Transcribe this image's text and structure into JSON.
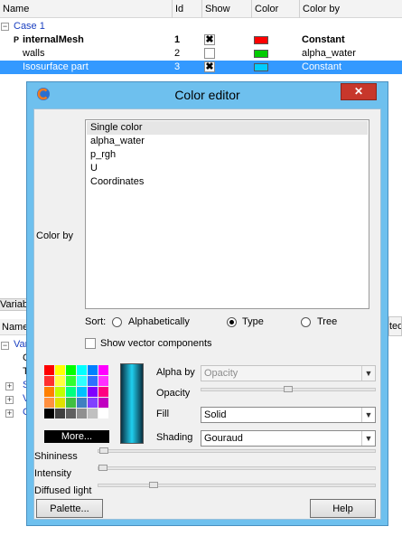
{
  "tree": {
    "columns": [
      "Name",
      "Id",
      "Show",
      "Color",
      "Color by"
    ],
    "rows": [
      {
        "name": "Case 1",
        "id": "",
        "show": "",
        "color": "",
        "color_by": ""
      },
      {
        "name": "internalMesh",
        "id": "1",
        "show": "✖",
        "color": "#ff0000",
        "color_by": "Constant"
      },
      {
        "name": "walls",
        "id": "2",
        "show": "",
        "color": "#00cc00",
        "color_by": "alpha_water"
      },
      {
        "name": "Isosurface part",
        "id": "3",
        "show": "✖",
        "color": "#00ccff",
        "color_by": "Constant"
      }
    ],
    "expander_minus": "−",
    "expander_plus": "+"
  },
  "left_fragments": {
    "variables_tab": "Variab",
    "name_col": "Name",
    "right_col": "ted",
    "items": [
      "Var",
      "C",
      "T",
      "S",
      "V",
      "C"
    ]
  },
  "dialog": {
    "title": "Color editor",
    "close_glyph": "✕",
    "color_by_label": "Color by",
    "color_by_options": [
      "Single color",
      "alpha_water",
      "p_rgh",
      "U",
      "Coordinates"
    ],
    "sort_label": "Sort:",
    "sort_options": [
      "Alphabetically",
      "Type",
      "Tree"
    ],
    "sort_selected": "Type",
    "vector_components_label": "Show vector components",
    "more_label": "More...",
    "alpha_by_label": "Alpha by",
    "alpha_by_value": "Opacity",
    "opacity_label": "Opacity",
    "opacity_level": 0.5,
    "fill_label": "Fill",
    "fill_value": "Solid",
    "shading_label": "Shading",
    "shading_value": "Gouraud",
    "shininess_label": "Shininess",
    "shininess_level": 0.02,
    "intensity_label": "Intensity",
    "intensity_level": 0.0,
    "diffused_label": "Diffused light",
    "diffused_level": 0.2,
    "palette_button": "Palette...",
    "help_button": "Help",
    "palette_colors": [
      "#ff0000",
      "#ffff00",
      "#00ff00",
      "#00ffff",
      "#0080ff",
      "#ff00ff",
      "#ff3030",
      "#ffff40",
      "#30ff30",
      "#30ffff",
      "#3070ff",
      "#ff30ff",
      "#ff8000",
      "#c0ff00",
      "#00ff80",
      "#00c0ff",
      "#8000ff",
      "#ff0080",
      "#ff9040",
      "#e0e000",
      "#40c040",
      "#4080c0",
      "#8040ff",
      "#c000c0",
      "#000000",
      "#404040",
      "#606060",
      "#909090",
      "#c0c0c0",
      "#ffffff"
    ]
  }
}
